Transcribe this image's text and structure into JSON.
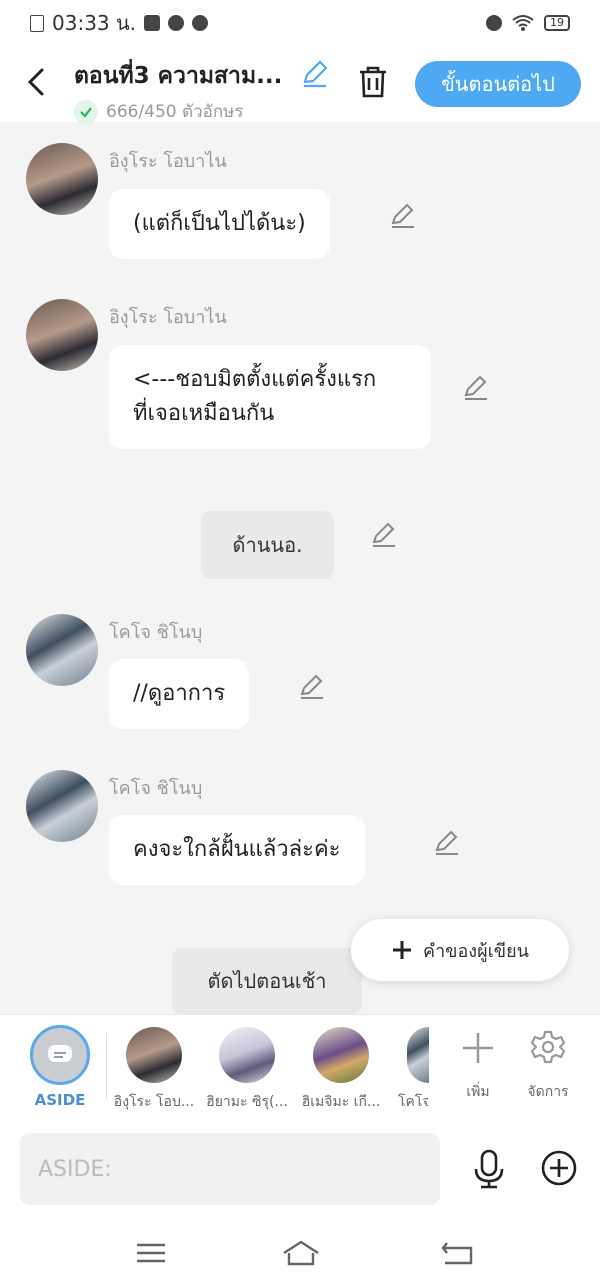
{
  "status_bar": {
    "time": "03:33 น.",
    "battery": "19"
  },
  "header": {
    "title": "ตอนที่3 ความสาม...",
    "char_count": "666/450 ตัวอักษร",
    "next_label": "ขั้นตอนต่อไป",
    "accent": "#4ea8f2"
  },
  "messages": [
    {
      "type": "char",
      "name": "อิงุโระ โอบาไน",
      "lines": [
        "(แต่ก็เป็นไปได้นะ)"
      ]
    },
    {
      "type": "char",
      "name": "อิงุโระ โอบาไน",
      "lines": [
        "<---ชอบมิตตั้งแต่ครั้งแรก",
        "ที่เจอเหมือนกัน"
      ]
    },
    {
      "type": "narration",
      "text": "ด้านนอ."
    },
    {
      "type": "char",
      "name": "โคโจ ชิโนบุ",
      "lines": [
        "//ดูอาการ"
      ]
    },
    {
      "type": "char",
      "name": "โคโจ ชิโนบุ",
      "lines": [
        "คงจะใกล้ฝั้นแล้วล่ะค่ะ"
      ]
    },
    {
      "type": "narration",
      "text": "ตัดไปตอนเช้า"
    }
  ],
  "fab": {
    "label": "คำของผู้เขียน"
  },
  "character_bar": {
    "aside_label": "ASIDE",
    "characters": [
      "อิงุโระ โอบ...",
      "ฮิยามะ ซิรุ(...",
      "ฮิเมจิมะ เกี...",
      "โคโจ"
    ],
    "add_label": "เพิ่ม",
    "manage_label": "จัดการ"
  },
  "input": {
    "placeholder": "ASIDE:"
  }
}
